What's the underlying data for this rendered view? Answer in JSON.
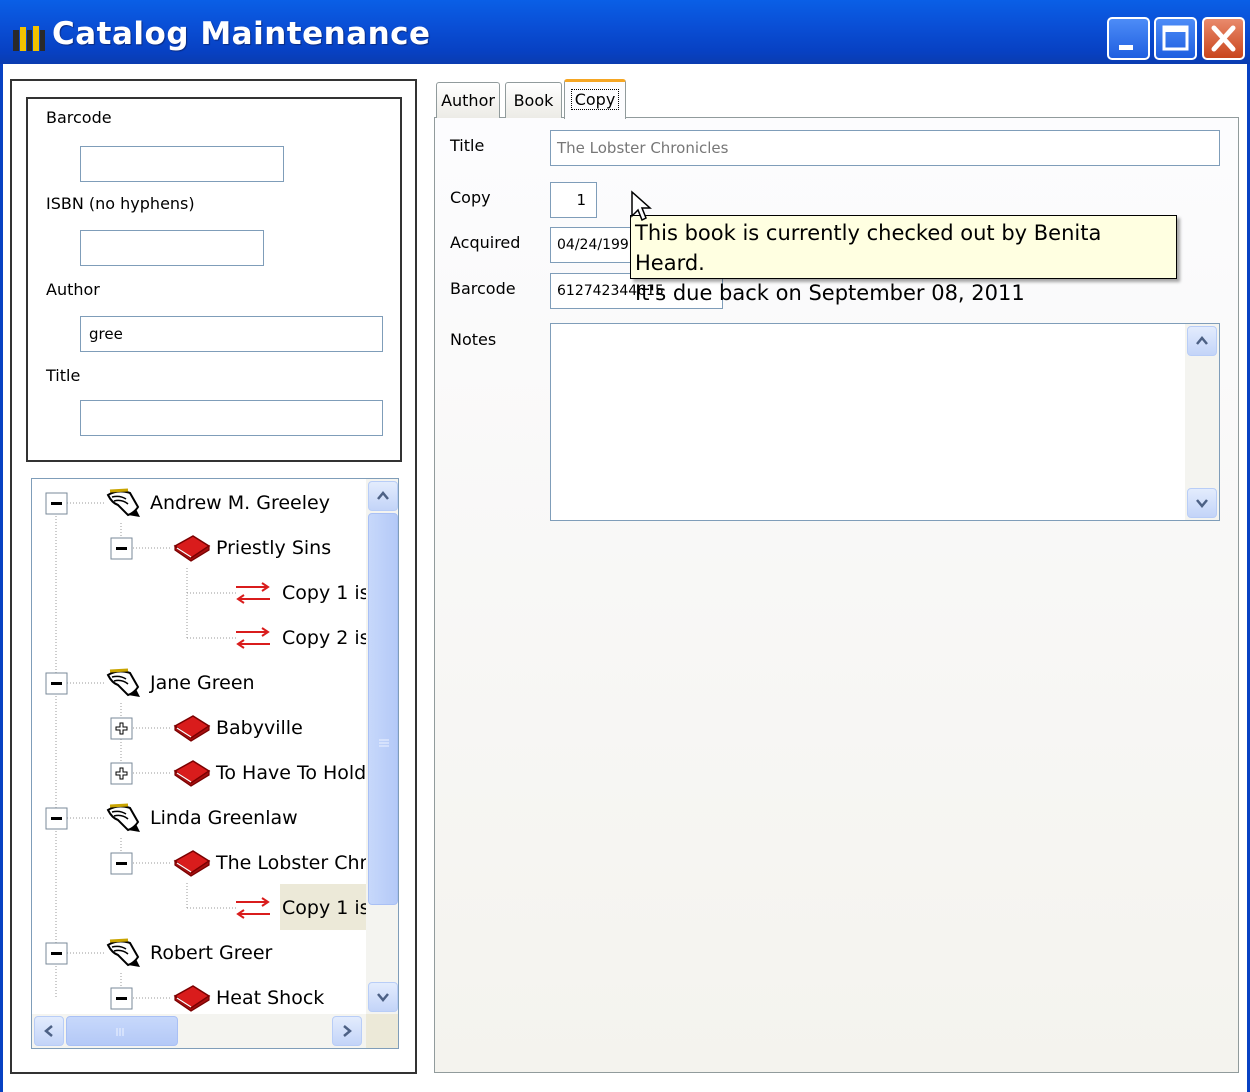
{
  "window": {
    "title": "Catalog Maintenance"
  },
  "search": {
    "barcode_label": "Barcode",
    "barcode_value": "",
    "isbn_label": "ISBN (no hyphens)",
    "isbn_value": "",
    "author_label": "Author",
    "author_value": "gree",
    "title_label": "Title",
    "title_value": ""
  },
  "tree": {
    "nodes": [
      {
        "label": "Andrew M. Greeley",
        "type": "author",
        "expanded": true
      },
      {
        "label": "Priestly Sins",
        "type": "book",
        "expanded": true
      },
      {
        "label": "Copy 1 is",
        "type": "copy"
      },
      {
        "label": "Copy 2 is",
        "type": "copy"
      },
      {
        "label": "Jane Green",
        "type": "author",
        "expanded": true
      },
      {
        "label": "Babyville",
        "type": "book",
        "expanded": false
      },
      {
        "label": "To Have To Hold",
        "type": "book",
        "expanded": false
      },
      {
        "label": "Linda Greenlaw",
        "type": "author",
        "expanded": true
      },
      {
        "label": "The Lobster Chr",
        "type": "book",
        "expanded": true
      },
      {
        "label": "Copy 1 is",
        "type": "copy",
        "selected": true
      },
      {
        "label": "Robert Greer",
        "type": "author",
        "expanded": true
      },
      {
        "label": "Heat Shock",
        "type": "book",
        "expanded": true
      }
    ]
  },
  "tabs": [
    "Author",
    "Book",
    "Copy"
  ],
  "active_tab": "Copy",
  "copy": {
    "title_label": "Title",
    "title_value": "The Lobster Chronicles",
    "copy_label": "Copy",
    "copy_value": "1",
    "acquired_label": "Acquired",
    "acquired_value": "04/24/199",
    "barcode_label": "Barcode",
    "barcode_value": "612742344615",
    "notes_label": "Notes",
    "notes_value": ""
  },
  "tooltip": {
    "line1": "This book is currently checked out by Benita Heard.",
    "line2": "It's due back on September 08, 2011"
  },
  "colors": {
    "titlebar": "#0a4fd6",
    "close_button": "#d35a33",
    "tooltip_bg": "#ffffe1",
    "active_tab_accent": "#f5a623",
    "book_icon": "#d91c1c"
  }
}
